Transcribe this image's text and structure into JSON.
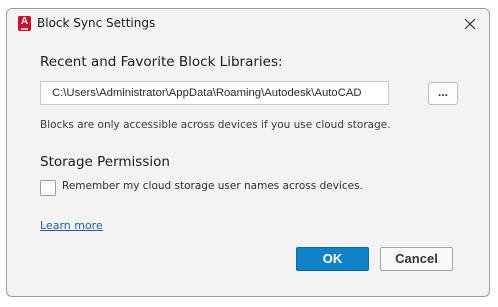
{
  "window": {
    "title": "Block Sync Settings",
    "app_icon_letter": "A",
    "icon_name": "autocad-app-icon",
    "close_icon": "close-icon"
  },
  "libraries": {
    "heading": "Recent and Favorite Block Libraries:",
    "path_value": "C:\\Users\\Administrator\\AppData\\Roaming\\Autodesk\\AutoCAD",
    "browse_label": "...",
    "note": "Blocks are only accessible across devices if you use cloud storage."
  },
  "storage": {
    "heading": "Storage Permission",
    "remember_label": "Remember my cloud storage user names across devices.",
    "remember_checked": false
  },
  "learn_more": "Learn more",
  "buttons": {
    "ok": "OK",
    "cancel": "Cancel"
  },
  "colors": {
    "primary_button": "#0f82c8",
    "link": "#1f5fa8",
    "app_icon": "#c8102e",
    "dialog_bg": "#f3f3f3"
  }
}
